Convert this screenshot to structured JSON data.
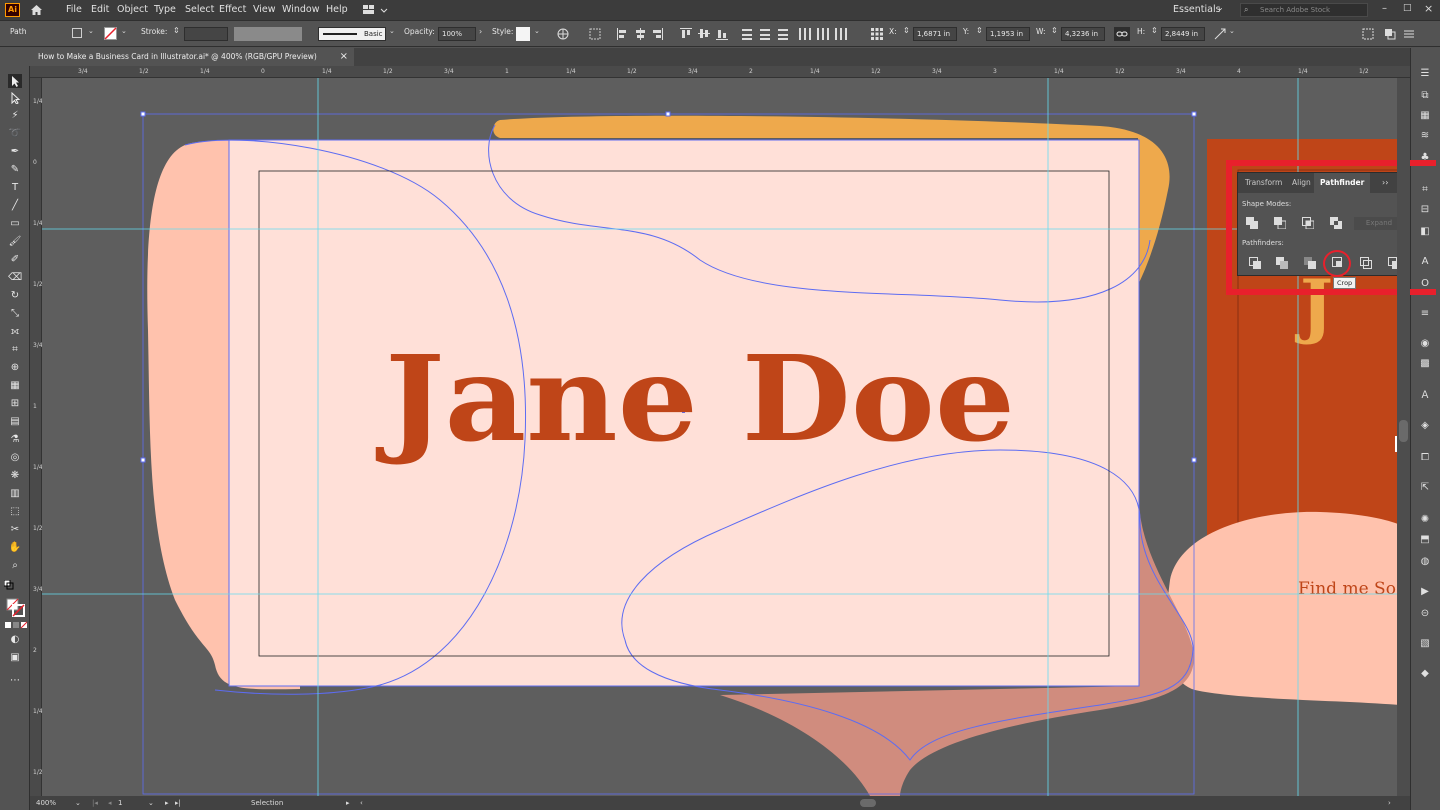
{
  "app": {
    "logo": "Ai"
  },
  "menu": [
    "File",
    "Edit",
    "Object",
    "Type",
    "Select",
    "Effect",
    "View",
    "Window",
    "Help"
  ],
  "workspace": {
    "label": "Essentials",
    "search_placeholder": "Search Adobe Stock"
  },
  "control_bar": {
    "selection_type": "Path",
    "stroke_label": "Stroke:",
    "brush_label": "Basic",
    "opacity_label": "Opacity:",
    "opacity_value": "100%",
    "style_label": "Style:",
    "x_label": "X:",
    "x_value": "1,6871 in",
    "y_label": "Y:",
    "y_value": "1,1953 in",
    "w_label": "W:",
    "w_value": "4,3236 in",
    "h_label": "H:",
    "h_value": "2,8449 in"
  },
  "document_tab": {
    "title": "How to Make a Business Card in Illustrator.ai* @ 400% (RGB/GPU Preview)",
    "close": "×"
  },
  "ruler": {
    "top_marks": [
      "3/4",
      "1/2",
      "1/4",
      "0",
      "1/4",
      "1/2",
      "3/4",
      "1",
      "1/4",
      "1/2",
      "3/4",
      "2",
      "1/4",
      "1/2",
      "3/4",
      "3",
      "1/4",
      "1/2",
      "3/4",
      "4",
      "1/4",
      "1/2"
    ],
    "left_marks": [
      "1/4",
      "0",
      "1/4",
      "1/2",
      "3/4",
      "1",
      "1/4",
      "1/2",
      "3/4",
      "2",
      "1/4",
      "1/2"
    ]
  },
  "artboard": {
    "name_text": "Jane Doe",
    "side_text": "Find me So"
  },
  "pathfinder": {
    "tabs": [
      "Transform",
      "Align",
      "Pathfinder"
    ],
    "active_tab": "Pathfinder",
    "shape_modes_label": "Shape Modes:",
    "expand_label": "Expand",
    "pathfinders_label": "Pathfinders:",
    "tooltip": "Crop"
  },
  "status": {
    "zoom": "400%",
    "artboard_number": "1",
    "tool": "Selection"
  },
  "colors": {
    "accent": "#e8202c",
    "brand_orange": "#bf4518",
    "peach": "#ffe0d8",
    "salmon": "#ffc2ad",
    "gold": "#eea94c"
  }
}
